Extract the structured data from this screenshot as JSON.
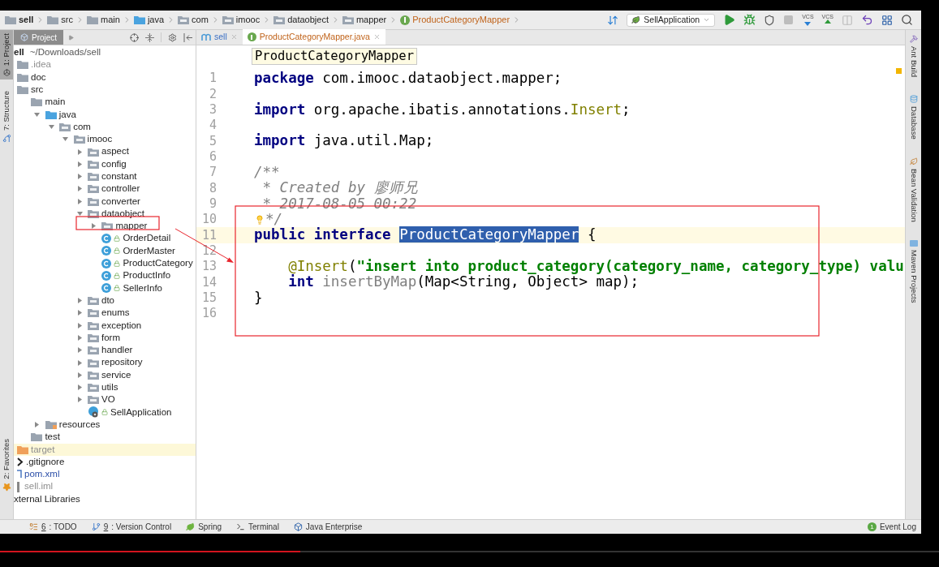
{
  "breadcrumbs": [
    {
      "label": "sell",
      "kind": "module"
    },
    {
      "label": "src",
      "kind": "folder"
    },
    {
      "label": "main",
      "kind": "folder"
    },
    {
      "label": "java",
      "kind": "source"
    },
    {
      "label": "com",
      "kind": "package"
    },
    {
      "label": "imooc",
      "kind": "package"
    },
    {
      "label": "dataobject",
      "kind": "package"
    },
    {
      "label": "mapper",
      "kind": "package"
    },
    {
      "label": "ProductCategoryMapper",
      "kind": "interface"
    }
  ],
  "run_config": "SellApplication",
  "toolbar": [
    {
      "kind": "sort",
      "disabled": false
    },
    {
      "kind": "run",
      "disabled": false
    },
    {
      "kind": "debug",
      "disabled": false
    },
    {
      "kind": "coverage",
      "disabled": false
    },
    {
      "kind": "stop",
      "disabled": true
    },
    {
      "kind": "vcs-update",
      "label": "VCS",
      "disabled": false
    },
    {
      "kind": "vcs-commit",
      "label": "VCS",
      "disabled": false
    },
    {
      "kind": "compare",
      "disabled": true
    },
    {
      "kind": "revert",
      "disabled": false
    },
    {
      "kind": "structure",
      "disabled": false
    },
    {
      "kind": "search",
      "disabled": false
    }
  ],
  "left_strip": [
    {
      "label": "1: Project",
      "kind": "project",
      "selected": true
    },
    {
      "label": "7: Structure",
      "kind": "structure",
      "selected": false
    },
    {
      "label": "2: Favorites",
      "kind": "favorites",
      "selected": false
    }
  ],
  "right_strip": [
    {
      "label": "Ant Build",
      "kind": "ant"
    },
    {
      "label": "Database",
      "kind": "database"
    },
    {
      "label": "Bean Validation",
      "kind": "bean"
    },
    {
      "label": "Maven Projects",
      "kind": "maven"
    }
  ],
  "project_panel": {
    "title": "Project",
    "tree": {
      "name": "ell",
      "path": "~/Downloads/sell",
      "kind": "module",
      "highlighted": false,
      "children": [
        {
          "name": ".idea",
          "kind": "ignored-folder",
          "highlighted": false
        },
        {
          "name": "doc",
          "kind": "folder",
          "highlighted": false
        },
        {
          "name": "src",
          "kind": "folder",
          "highlighted": false,
          "children": [
            {
              "name": "main",
              "kind": "folder",
              "highlighted": false,
              "children": [
                {
                  "name": "java",
                  "kind": "source-folder",
                  "expanded": true,
                  "highlighted": false,
                  "children": [
                    {
                      "name": "com",
                      "kind": "package",
                      "expanded": true,
                      "highlighted": false,
                      "children": [
                        {
                          "name": "imooc",
                          "kind": "package",
                          "expanded": true,
                          "highlighted": false,
                          "children": [
                            {
                              "name": "aspect",
                              "kind": "package",
                              "expanded": false,
                              "highlighted": false
                            },
                            {
                              "name": "config",
                              "kind": "package",
                              "expanded": false,
                              "highlighted": false
                            },
                            {
                              "name": "constant",
                              "kind": "package",
                              "expanded": false,
                              "highlighted": false
                            },
                            {
                              "name": "controller",
                              "kind": "package",
                              "expanded": false,
                              "highlighted": false
                            },
                            {
                              "name": "converter",
                              "kind": "package",
                              "expanded": false,
                              "highlighted": false
                            },
                            {
                              "name": "dataobject",
                              "kind": "package",
                              "expanded": true,
                              "highlighted": false,
                              "children": [
                                {
                                  "name": "mapper",
                                  "kind": "package",
                                  "expanded": false,
                                  "highlighted": false
                                },
                                {
                                  "name": "OrderDetail",
                                  "kind": "class",
                                  "highlighted": false
                                },
                                {
                                  "name": "OrderMaster",
                                  "kind": "class",
                                  "highlighted": false
                                },
                                {
                                  "name": "ProductCategory",
                                  "kind": "class",
                                  "highlighted": false
                                },
                                {
                                  "name": "ProductInfo",
                                  "kind": "class",
                                  "highlighted": false
                                },
                                {
                                  "name": "SellerInfo",
                                  "kind": "class",
                                  "highlighted": false
                                }
                              ]
                            },
                            {
                              "name": "dto",
                              "kind": "package",
                              "expanded": false,
                              "highlighted": false
                            },
                            {
                              "name": "enums",
                              "kind": "package",
                              "expanded": false,
                              "highlighted": false
                            },
                            {
                              "name": "exception",
                              "kind": "package",
                              "expanded": false,
                              "highlighted": false
                            },
                            {
                              "name": "form",
                              "kind": "package",
                              "expanded": false,
                              "highlighted": false
                            },
                            {
                              "name": "handler",
                              "kind": "package",
                              "expanded": false,
                              "highlighted": false
                            },
                            {
                              "name": "repository",
                              "kind": "package",
                              "expanded": false,
                              "highlighted": false
                            },
                            {
                              "name": "service",
                              "kind": "package",
                              "expanded": false,
                              "highlighted": false
                            },
                            {
                              "name": "utils",
                              "kind": "package",
                              "expanded": false,
                              "highlighted": false
                            },
                            {
                              "name": "VO",
                              "kind": "package",
                              "expanded": false,
                              "highlighted": false
                            },
                            {
                              "name": "SellApplication",
                              "kind": "app-class",
                              "highlighted": false
                            }
                          ]
                        }
                      ]
                    }
                  ]
                },
                {
                  "name": "resources",
                  "kind": "resources-folder",
                  "expanded": false,
                  "highlighted": false
                }
              ]
            },
            {
              "name": "test",
              "kind": "folder",
              "highlighted": false
            }
          ]
        },
        {
          "name": "target",
          "kind": "excluded-folder",
          "highlighted": true
        },
        {
          "name": ".gitignore",
          "kind": "ignore-file",
          "highlighted": false
        },
        {
          "name": "pom.xml",
          "kind": "maven-file",
          "highlighted": false
        },
        {
          "name": "sell.iml",
          "kind": "iml-file",
          "highlighted": false
        }
      ]
    },
    "libraries": {
      "name": "xternal Libraries",
      "highlighted": false
    }
  },
  "tabs": [
    {
      "label": "sell",
      "kind": "maven",
      "selected": false
    },
    {
      "label": "ProductCategoryMapper.java",
      "kind": "interface",
      "selected": true
    }
  ],
  "editor": {
    "tooltip": "ProductCategoryMapper",
    "lines": [
      {
        "number": "1",
        "current": false,
        "tokens": [
          {
            "kind": "keyword",
            "text": "package"
          },
          {
            "kind": "plain",
            "text": " com.imooc.dataobject.mapper;"
          }
        ]
      },
      {
        "number": "2",
        "current": false
      },
      {
        "number": "3",
        "current": false,
        "tokens": [
          {
            "kind": "keyword",
            "text": "import"
          },
          {
            "kind": "plain",
            "text": " org.apache.ibatis.annotations."
          },
          {
            "kind": "annotation",
            "text": "Insert"
          },
          {
            "kind": "plain",
            "text": ";"
          }
        ]
      },
      {
        "number": "4",
        "current": false
      },
      {
        "number": "5",
        "current": false,
        "tokens": [
          {
            "kind": "keyword",
            "text": "import"
          },
          {
            "kind": "plain",
            "text": " java.util.Map;"
          }
        ]
      },
      {
        "number": "6",
        "current": false
      },
      {
        "number": "7",
        "current": false,
        "tokens": [
          {
            "kind": "comment",
            "text": "/**"
          }
        ]
      },
      {
        "number": "8",
        "current": false,
        "tokens": [
          {
            "kind": "comment",
            "text": " * Created by 廖师兄"
          }
        ]
      },
      {
        "number": "9",
        "current": false,
        "tokens": [
          {
            "kind": "comment",
            "text": " * 2017-08-05 00:22"
          }
        ]
      },
      {
        "number": "10",
        "current": false,
        "bulb": true,
        "tokens": [
          {
            "kind": "comment",
            "text": "*/"
          }
        ]
      },
      {
        "number": "11",
        "current": true,
        "tokens": [
          {
            "kind": "keyword",
            "text": "public interface "
          },
          {
            "kind": "selected",
            "text": "ProductCategoryMapper"
          },
          {
            "kind": "plain",
            "text": " {"
          }
        ]
      },
      {
        "number": "12",
        "current": false
      },
      {
        "number": "13",
        "current": false,
        "tokens": [
          {
            "kind": "annotation",
            "text": "    @Insert"
          },
          {
            "kind": "plain",
            "text": "("
          },
          {
            "kind": "string",
            "text": "\"insert into product_category(category_name, category_type) valu"
          }
        ]
      },
      {
        "number": "14",
        "current": false,
        "tokens": [
          {
            "kind": "keyword",
            "text": "    int"
          },
          {
            "kind": "unused",
            "text": " insertByMap"
          },
          {
            "kind": "plain",
            "text": "(Map<String, Object> map);"
          }
        ]
      },
      {
        "number": "15",
        "current": false,
        "tokens": [
          {
            "kind": "plain",
            "text": "}"
          }
        ]
      },
      {
        "number": "16",
        "current": false
      }
    ]
  },
  "annotations": [
    {
      "kind": "frame"
    },
    {
      "kind": "frame"
    },
    {
      "kind": "arrow"
    }
  ],
  "bottom_bar": [
    {
      "key": "6",
      "label": ": TODO",
      "kind": "todo"
    },
    {
      "key": "9",
      "label": ": Version Control",
      "kind": "vcs"
    },
    {
      "label": "Spring",
      "kind": "spring"
    },
    {
      "label": "Terminal",
      "kind": "terminal"
    },
    {
      "label": "Java Enterprise",
      "kind": "javaee"
    }
  ],
  "event_log": {
    "count": "1",
    "label": "Event Log"
  },
  "video_progress": {
    "level": 0.32
  }
}
